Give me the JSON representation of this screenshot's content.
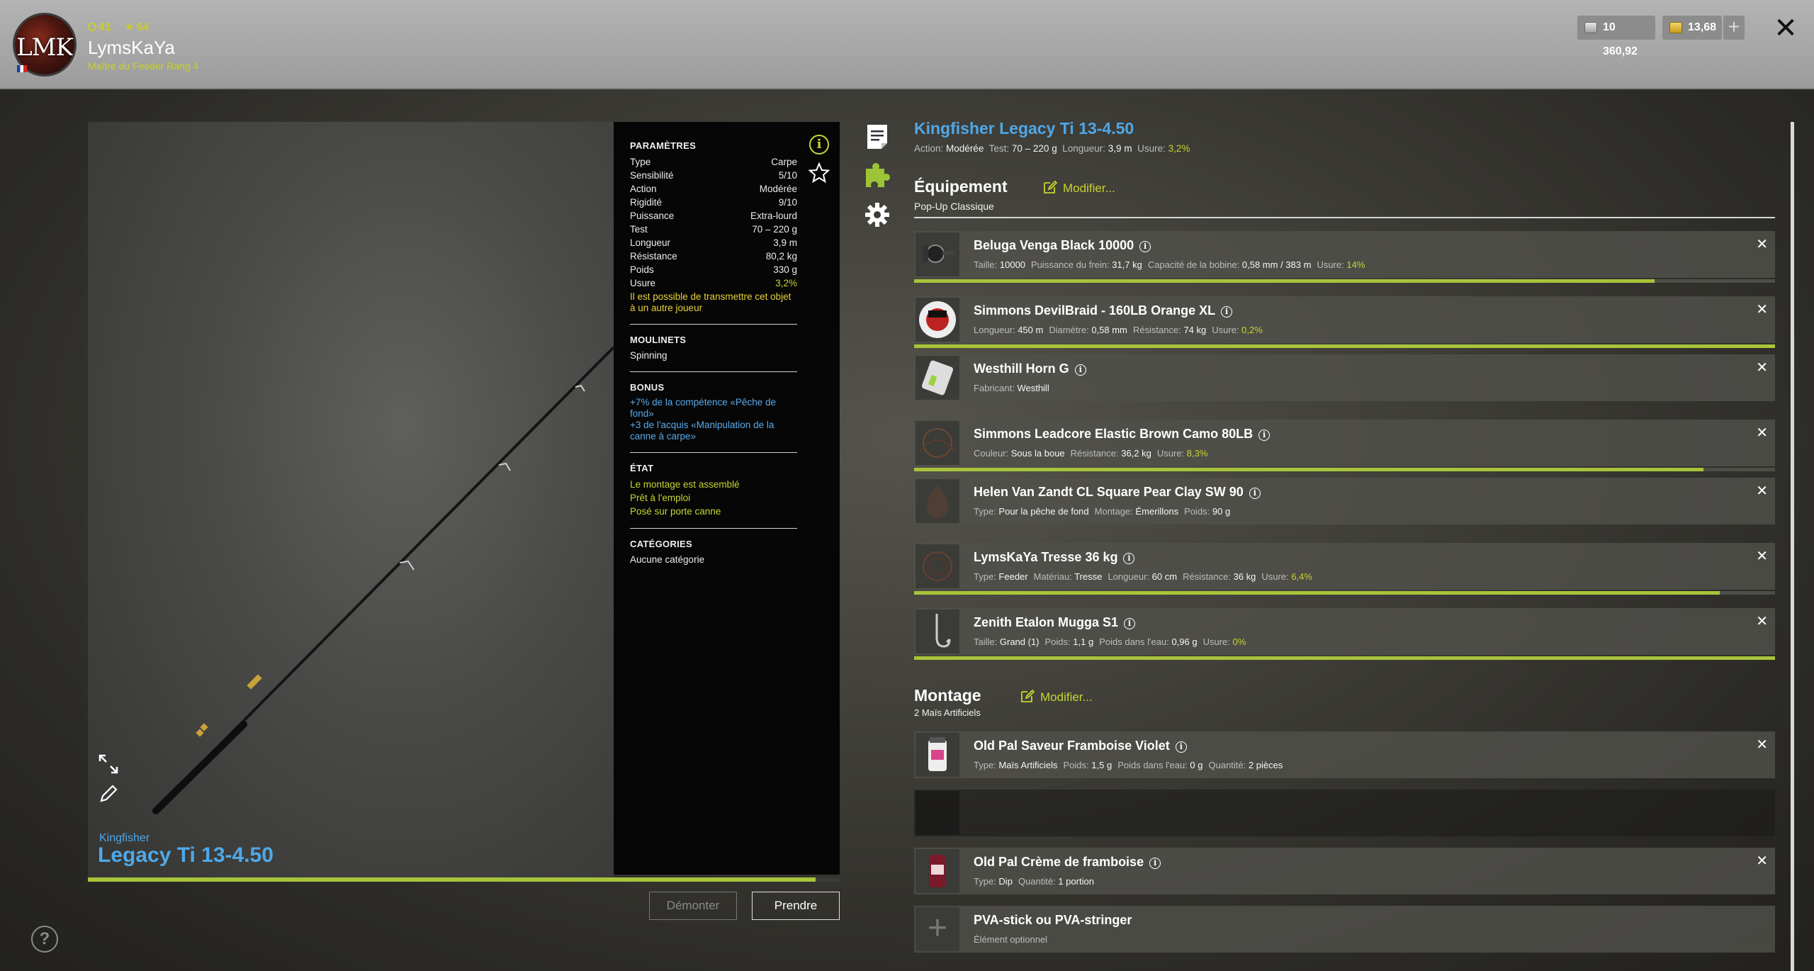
{
  "player": {
    "initials": "LMK",
    "level": "41",
    "stars": "64",
    "name": "LymsKaYa",
    "rank": "Maître du Feeder Rang 4"
  },
  "currency": {
    "silver": "10 360,92",
    "gold": "13,68",
    "add": "+"
  },
  "close": "✕",
  "preview": {
    "brand": "Kingfisher",
    "model": "Legacy Ti 13-4.50",
    "wear_fraction": 0.968
  },
  "params": {
    "section": "PARAMÈTRES",
    "rows": [
      {
        "k": "Type",
        "v": "Carpe"
      },
      {
        "k": "Sensibilité",
        "v": "5/10"
      },
      {
        "k": "Action",
        "v": "Modérée"
      },
      {
        "k": "Rigidité",
        "v": "9/10"
      },
      {
        "k": "Puissance",
        "v": "Extra-lourd"
      },
      {
        "k": "Test",
        "v": "70 – 220 g"
      },
      {
        "k": "Longueur",
        "v": "3,9 m"
      },
      {
        "k": "Résistance",
        "v": "80,2 kg"
      },
      {
        "k": "Poids",
        "v": "330 g"
      },
      {
        "k": "Usure",
        "v": "3,2%"
      }
    ],
    "transfer_note": "Il est possible de transmettre cet objet à un autre joueur",
    "reels_head": "MOULINETS",
    "reels_value": "Spinning",
    "bonus_head": "BONUS",
    "bonus_1": "+7% de la compétence «Pêche de fond»",
    "bonus_2": "+3 de l'acquis «Manipulation de la canne à carpe»",
    "state_head": "ÉTAT",
    "state_1": "Le montage est assemblé",
    "state_2": "Prêt à l'emploi",
    "state_3": "Posé sur porte canne",
    "cat_head": "CATÉGORIES",
    "cat_value": "Aucune catégorie"
  },
  "buttons": {
    "dismantle": "Démonter",
    "take": "Prendre"
  },
  "rod": {
    "title": "Kingfisher Legacy Ti 13-4.50",
    "action_label": "Action:",
    "action": "Modérée",
    "test_label": "Test:",
    "test": "70 – 220 g",
    "length_label": "Longueur:",
    "length": "3,9 m",
    "wear_label": "Usure:",
    "wear": "3,2%"
  },
  "equipment": {
    "title": "Équipement",
    "modify": "Modifier...",
    "subtitle": "Pop-Up Classique"
  },
  "items": [
    {
      "name": "Beluga Venga Black 10000",
      "det": [
        [
          "Taille:",
          "10000"
        ],
        [
          "Puissance du frein:",
          "31,7 kg"
        ],
        [
          "Capacité de la bobine:",
          "0,58 mm / 383 m"
        ]
      ],
      "wear_label": "Usure:",
      "wear": "14%",
      "bar": 0.86
    },
    {
      "name": "Simmons DevilBraid - 160LB Orange XL",
      "det": [
        [
          "Longueur:",
          "450 m"
        ],
        [
          "Diamètre:",
          "0,58 mm"
        ],
        [
          "Résistance:",
          "74 kg"
        ]
      ],
      "wear_label": "Usure:",
      "wear": "0,2%",
      "bar": 1.0
    },
    {
      "name": "Westhill Horn G",
      "det": [
        [
          "Fabricant:",
          "Westhill"
        ]
      ]
    },
    {
      "name": "Simmons Leadcore Elastic Brown Camo 80LB",
      "det": [
        [
          "Couleur:",
          "Sous la boue"
        ],
        [
          "Résistance:",
          "36,2 kg"
        ]
      ],
      "wear_label": "Usure:",
      "wear": "8,3%",
      "bar": 0.917
    },
    {
      "name": "Helen Van Zandt CL Square Pear Clay SW 90",
      "det": [
        [
          "Type:",
          "Pour la pêche de fond"
        ],
        [
          "Montage:",
          "Émerillons"
        ],
        [
          "Poids:",
          "90 g"
        ]
      ]
    },
    {
      "name": "LymsKaYa Tresse 36 kg",
      "det": [
        [
          "Type:",
          "Feeder"
        ],
        [
          "Matériau:",
          "Tresse"
        ],
        [
          "Longueur:",
          "60 cm"
        ],
        [
          "Résistance:",
          "36 kg"
        ]
      ],
      "wear_label": "Usure:",
      "wear": "6,4%",
      "bar": 0.936
    },
    {
      "name": "Zenith Etalon Mugga S1",
      "det": [
        [
          "Taille:",
          "Grand (1)"
        ],
        [
          "Poids:",
          "1,1 g"
        ],
        [
          "Poids dans l'eau:",
          "0,96 g"
        ]
      ],
      "wear_label": "Usure:",
      "wear": "0%",
      "bar": 1.0
    }
  ],
  "montage": {
    "title": "Montage",
    "modify": "Modifier...",
    "subtitle": "2 Maïs Artificiels"
  },
  "bait": [
    {
      "name": "Old Pal Saveur Framboise Violet",
      "det": [
        [
          "Type:",
          "Maïs Artificiels"
        ],
        [
          "Poids:",
          "1,5 g"
        ],
        [
          "Poids dans l'eau:",
          "0 g"
        ],
        [
          "Quantité:",
          "2 pièces"
        ]
      ]
    },
    {
      "name": "Old Pal Crème de framboise",
      "det": [
        [
          "Type:",
          "Dip"
        ],
        [
          "Quantité:",
          "1 portion"
        ]
      ]
    }
  ],
  "pva": {
    "name": "PVA-stick ou PVA-stringer",
    "sub": "Élément optionnel"
  },
  "help": "?",
  "icons": [
    "info-icon",
    "star-icon",
    "expand-icon",
    "pencil-icon",
    "document-icon",
    "puzzle-icon",
    "gear-icon",
    "close-icon",
    "plus-icon",
    "help-icon"
  ],
  "colors": {
    "accent": "#a8c43a",
    "title_blue": "#4fa8e8",
    "warning": "#e6d23c"
  }
}
